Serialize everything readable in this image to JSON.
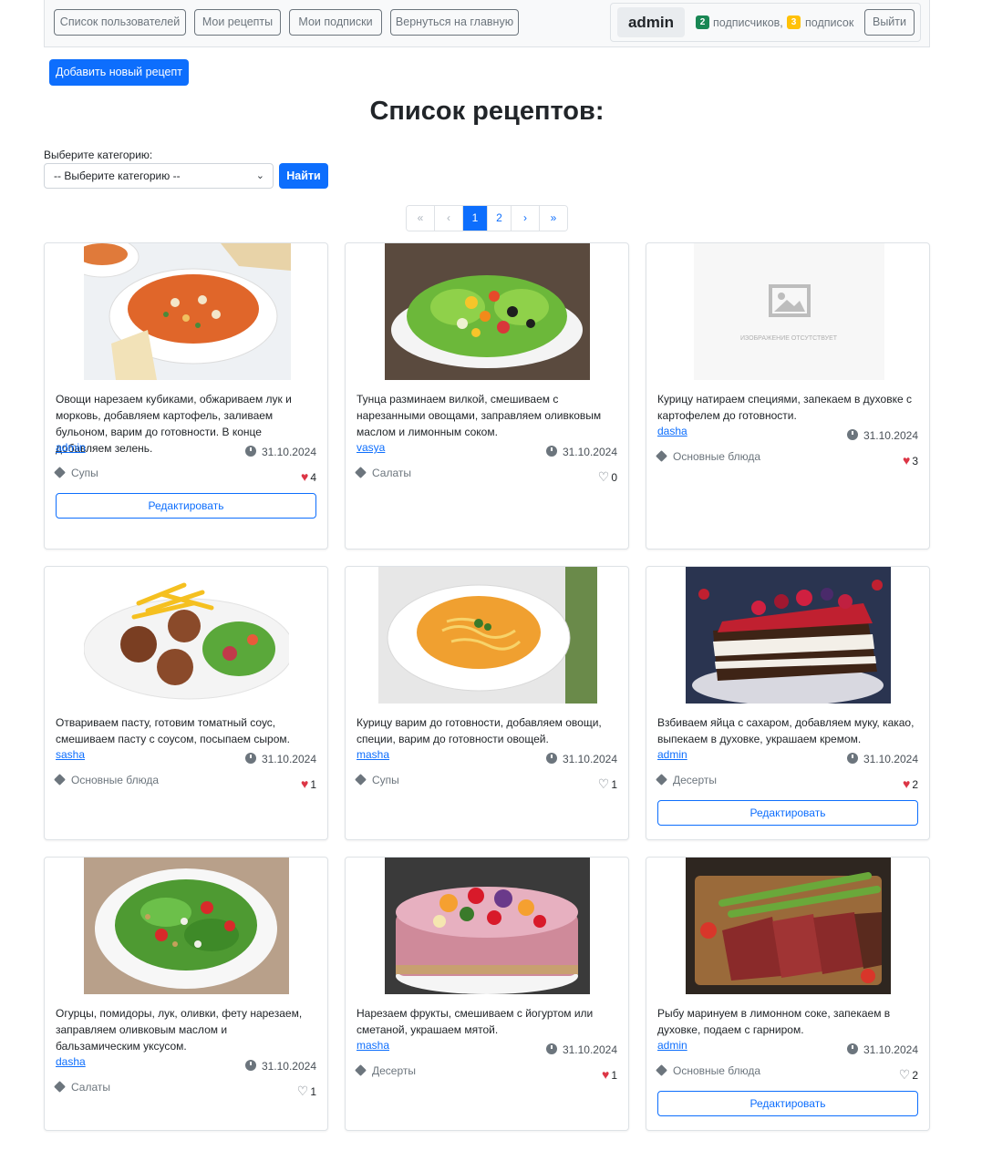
{
  "nav": {
    "users": "Список пользователей",
    "my_recipes": "Мои рецепты",
    "my_subscriptions": "Мои подписки",
    "home": "Вернуться на главную",
    "username": "admin",
    "followers_count": "2",
    "followers_label": "подписчиков,",
    "following_count": "3",
    "following_label": "подписок",
    "logout": "Выйти"
  },
  "add_recipe": "Добавить новый рецепт",
  "title": "Список рецептов:",
  "filter": {
    "label": "Выберите категорию:",
    "selected": "-- Выберите категорию --",
    "button": "Найти"
  },
  "pagination": {
    "first": "«",
    "prev": "‹",
    "pages": [
      "1",
      "2"
    ],
    "current": "1",
    "next": "›",
    "last": "»"
  },
  "edit_label": "Редактировать",
  "no_image_text": "ИЗОБРАЖЕНИЕ ОТСУТСТВУЕТ",
  "recipes": [
    {
      "text": "Овощи нарезаем кубиками, обжариваем лук и морковь, добавляем картофель, заливаем бульоном, варим до готовности. В конце добавляем зелень.",
      "author": "admin",
      "date": "31.10.2024",
      "category": "Супы",
      "likes": "4",
      "liked": true,
      "editable": true,
      "image": "soup-tomato"
    },
    {
      "text": "Тунца разминаем вилкой, смешиваем с нарезанными овощами, заправляем оливковым маслом и лимонным соком.",
      "author": "vasya",
      "date": "31.10.2024",
      "category": "Салаты",
      "likes": "0",
      "liked": false,
      "editable": false,
      "image": "salad-tuna"
    },
    {
      "text": "Курицу натираем специями, запекаем в духовке с картофелем до готовности.",
      "author": "dasha",
      "date": "31.10.2024",
      "category": "Основные блюда",
      "likes": "3",
      "liked": true,
      "editable": false,
      "image": "none"
    },
    {
      "text": "Отвариваем пасту, готовим томатный соус, смешиваем пасту с соусом, посыпаем сыром.",
      "author": "sasha",
      "date": "31.10.2024",
      "category": "Основные блюда",
      "likes": "1",
      "liked": true,
      "editable": false,
      "image": "meatballs"
    },
    {
      "text": "Курицу варим до готовности, добавляем овощи, специи, варим до готовности овощей.",
      "author": "masha",
      "date": "31.10.2024",
      "category": "Супы",
      "likes": "1",
      "liked": false,
      "editable": false,
      "image": "soup-noodle"
    },
    {
      "text": "Взбиваем яйца с сахаром, добавляем муку, какао, выпекаем в духовке, украшаем кремом.",
      "author": "admin",
      "date": "31.10.2024",
      "category": "Десерты",
      "likes": "2",
      "liked": true,
      "editable": true,
      "image": "cake-berry"
    },
    {
      "text": "Огурцы, помидоры, лук, оливки, фету нарезаем, заправляем оливковым маслом и бальзамическим уксусом.",
      "author": "dasha",
      "date": "31.10.2024",
      "category": "Салаты",
      "likes": "1",
      "liked": false,
      "editable": false,
      "image": "salad-green"
    },
    {
      "text": "Нарезаем фрукты, смешиваем с йогуртом или сметаной, украшаем мятой.",
      "author": "masha",
      "date": "31.10.2024",
      "category": "Десерты",
      "likes": "1",
      "liked": true,
      "editable": false,
      "image": "cake-fruit"
    },
    {
      "text": "Рыбу маринуем в лимонном соке, запекаем в духовке, подаем с гарниром.",
      "author": "admin",
      "date": "31.10.2024",
      "category": "Основные блюда",
      "likes": "2",
      "liked": false,
      "editable": true,
      "image": "steak"
    }
  ]
}
